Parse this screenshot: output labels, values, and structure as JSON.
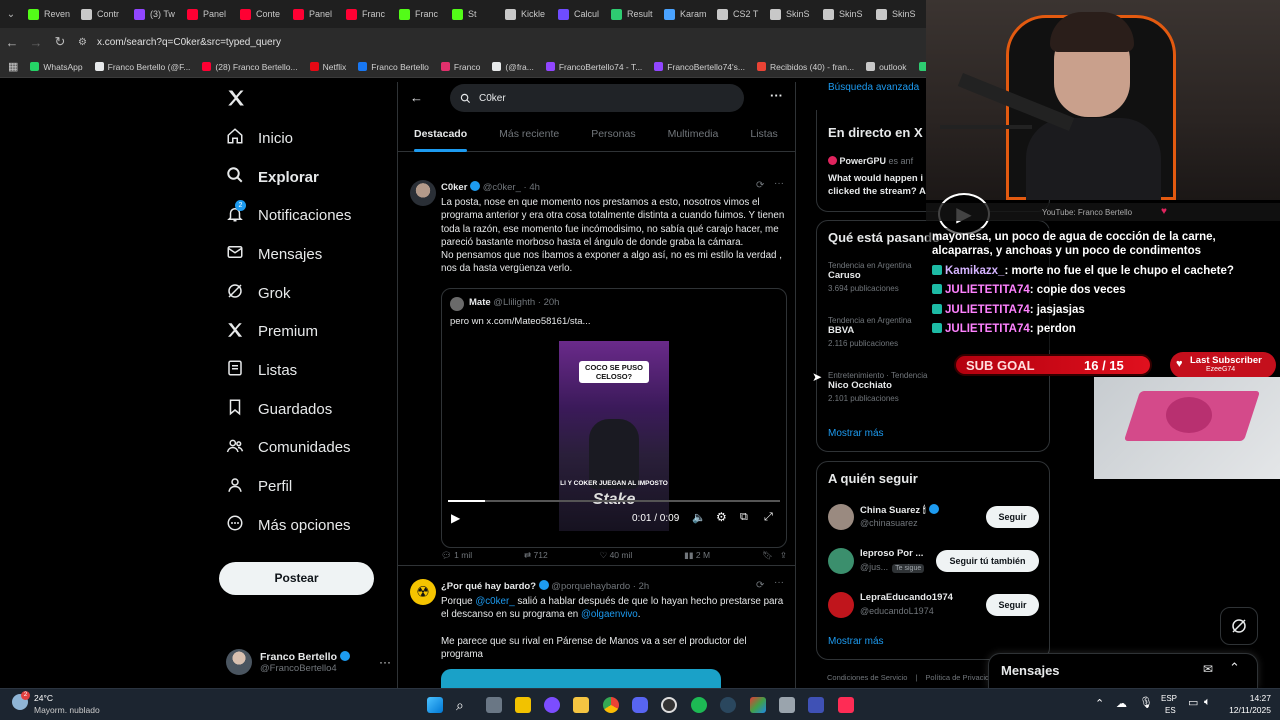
{
  "browser": {
    "tabs": [
      {
        "label": "Reven",
        "icon": "kick-icon",
        "color": "#53fc18"
      },
      {
        "label": "Contr",
        "icon": "steam-icon",
        "color": "#c8c8c8"
      },
      {
        "label": "(3) Tw",
        "icon": "twitch-icon",
        "color": "#9146ff"
      },
      {
        "label": "Panel",
        "icon": "youtube-icon",
        "color": "#ff0033"
      },
      {
        "label": "Conte",
        "icon": "youtube-icon",
        "color": "#ff0033"
      },
      {
        "label": "Panel",
        "icon": "youtube-icon",
        "color": "#ff0033"
      },
      {
        "label": "Franc",
        "icon": "youtube-icon",
        "color": "#ff0033"
      },
      {
        "label": "Franc",
        "icon": "kick-icon",
        "color": "#53fc18"
      },
      {
        "label": "St",
        "icon": "kick-icon",
        "color": "#53fc18"
      },
      {
        "label": "Kickle",
        "icon": "kickle-icon",
        "color": "#c8c8c8"
      },
      {
        "label": "Calcul",
        "icon": "calc-icon",
        "color": "#6f4cff"
      },
      {
        "label": "Result",
        "icon": "result-icon",
        "color": "#2ecc71"
      },
      {
        "label": "Karam",
        "icon": "karam-icon",
        "color": "#4aa3ff"
      },
      {
        "label": "CS2 T",
        "icon": "cs2-icon",
        "color": "#c8c8c8"
      },
      {
        "label": "SkinS",
        "icon": "x-icon",
        "color": "#c8c8c8"
      },
      {
        "label": "SkinS",
        "icon": "x-icon",
        "color": "#c8c8c8"
      },
      {
        "label": "SkinS",
        "icon": "x-icon",
        "color": "#c8c8c8"
      }
    ],
    "url": "x.com/search?q=C0ker&src=typed_query",
    "bookmarks": [
      {
        "label": "WhatsApp",
        "color": "#25d366"
      },
      {
        "label": "Franco Bertello (@F...",
        "color": "#e7e9ea"
      },
      {
        "label": "(28) Franco Bertello...",
        "color": "#ff0033"
      },
      {
        "label": "Netflix",
        "color": "#e50914"
      },
      {
        "label": "Franco Bertello",
        "color": "#1877f2"
      },
      {
        "label": "Franco",
        "color": "#e1306c"
      },
      {
        "label": "(@fra...",
        "color": "#e7e9ea"
      },
      {
        "label": "FrancoBertello74 - T...",
        "color": "#9146ff"
      },
      {
        "label": "FrancoBertello74's...",
        "color": "#9146ff"
      },
      {
        "label": "Recibidos (40) - fran...",
        "color": "#ea4335"
      },
      {
        "label": "outlook",
        "color": "#c8c8c8"
      },
      {
        "label": "Aler",
        "color": "#2ecc71"
      }
    ]
  },
  "nav": {
    "items": [
      {
        "label": "Inicio",
        "icon": "home-icon"
      },
      {
        "label": "Explorar",
        "icon": "search-icon",
        "bold": true
      },
      {
        "label": "Notificaciones",
        "icon": "bell-icon",
        "badge": "2"
      },
      {
        "label": "Mensajes",
        "icon": "mail-icon"
      },
      {
        "label": "Grok",
        "icon": "grok-icon"
      },
      {
        "label": "Premium",
        "icon": "x-logo-icon"
      },
      {
        "label": "Listas",
        "icon": "list-icon"
      },
      {
        "label": "Guardados",
        "icon": "bookmark-icon"
      },
      {
        "label": "Comunidades",
        "icon": "people-icon"
      },
      {
        "label": "Perfil",
        "icon": "person-icon"
      },
      {
        "label": "Más opciones",
        "icon": "more-circle-icon"
      }
    ],
    "post_label": "Postear",
    "profile": {
      "name": "Franco Bertello",
      "handle": "@FrancoBertello4"
    }
  },
  "search": {
    "query": "C0ker"
  },
  "tabs": [
    "Destacado",
    "Más reciente",
    "Personas",
    "Multimedia",
    "Listas"
  ],
  "tweets": [
    {
      "name": "C0ker",
      "handle": "@c0ker_",
      "time": "· 4h",
      "text": "La posta, nose en que momento nos prestamos a esto, nosotros vimos el programa anterior y era otra cosa totalmente distinta a cuando fuimos. Y tienen toda la razón, ese momento fue incómodisimo, no sabía qué carajo hacer, me pareció bastante morboso hasta el ángulo de donde graba la cámara.",
      "text2": "No pensamos que nos íbamos a exponer a algo así, no es mi estilo la verdad , nos da hasta vergüenza verlo.",
      "quote": {
        "name": "Mate",
        "handle": "@Llilighth",
        "time": "· 20h",
        "text": "pero wn  x.com/Mateo58161/sta...",
        "video_caption_top": "COCO SE PUSO CELOSO?",
        "video_caption_bottom": "LI Y COKER JUEGAN AL IMPOSTO",
        "video_brand": "Stake",
        "time_display": "0:01 / 0:09",
        "progress": 0.11
      },
      "stats": {
        "replies": "1 mil",
        "retweets": "712",
        "likes": "40 mil",
        "views": "2 M"
      }
    },
    {
      "name": "¿Por qué hay bardo?",
      "handle": "@porquehaybardo",
      "time": "· 2h",
      "text_pre": "Porque ",
      "mention1": "@c0ker_",
      "text_mid": " salió a hablar después de que lo hayan hecho prestarse para el descanso en su programa en ",
      "mention2": "@olgaenvivo",
      "text_end": ".",
      "text2": "Me parece que su rival en Párense de Manos va a ser el productor del programa"
    }
  ],
  "right": {
    "advanced_search": "Búsqueda avanzada",
    "live": {
      "title": "En directo en X",
      "host": "PowerGPU",
      "host_note": "es anf",
      "text": "What would happen i clicked the stream? A"
    },
    "trends": {
      "title": "Qué está pasando",
      "items": [
        {
          "context": "Tendencia en Argentina",
          "name": "Caruso",
          "count": "3.694 publicaciones"
        },
        {
          "context": "Tendencia en Argentina",
          "name": "BBVA",
          "count": "2.116 publicaciones"
        },
        {
          "context": "Entretenimiento · Tendencia",
          "name": "Nico Occhiato",
          "count": "2.101 publicaciones"
        }
      ],
      "more": "Mostrar más"
    },
    "follow": {
      "title": "A quién seguir",
      "items": [
        {
          "name": "China Suarez 🕯",
          "handle": "@chinasuarez",
          "button": "Seguir",
          "color": "#9a8a80"
        },
        {
          "name": "Ieproso Por ...",
          "handle": "@jus...",
          "badge": "Te sigue",
          "button": "Seguir tú también",
          "color": "#3b8f6d"
        },
        {
          "name": "LepraEducando1974",
          "handle": "@educandoL1974",
          "button": "Seguir",
          "color": "#c0151c"
        }
      ],
      "more": "Mostrar más"
    },
    "footer": [
      "Condiciones de Servicio",
      "|",
      "Política de Privacid"
    ]
  },
  "messages_drawer": {
    "title": "Mensajes"
  },
  "stream": {
    "source": "YouTube: Franco Bertello",
    "chat": [
      {
        "user": "",
        "msg": "mayonesa, un poco de agua de cocción de la carne, alcaparras, y anchoas y un poco de condimentos"
      },
      {
        "user": "Kamikazx_",
        "msg": ": morte no fue el que le chupo el cachete?"
      },
      {
        "user": "JULIETETITA74",
        "msg": ": copie dos veces"
      },
      {
        "user": "JULIETETITA74",
        "msg": ": jasjasjas"
      },
      {
        "user": "JULIETETITA74",
        "msg": ": perdon"
      }
    ],
    "sub_goal_label": "SUB GOAL",
    "sub_goal_value": "16 / 15",
    "last_sub_label": "Last Subscriber",
    "last_sub_name": "EzeeG74"
  },
  "taskbar": {
    "weather_temp": "24°C",
    "weather_desc": "Mayorm. nublado",
    "lang": "ESP",
    "lang2": "ES",
    "time": "14:27",
    "date": "12/11/2025"
  },
  "colors": {
    "accent": "#1d9bf0",
    "bg": "#000000",
    "border": "#2f3336",
    "muted": "#71767b"
  }
}
